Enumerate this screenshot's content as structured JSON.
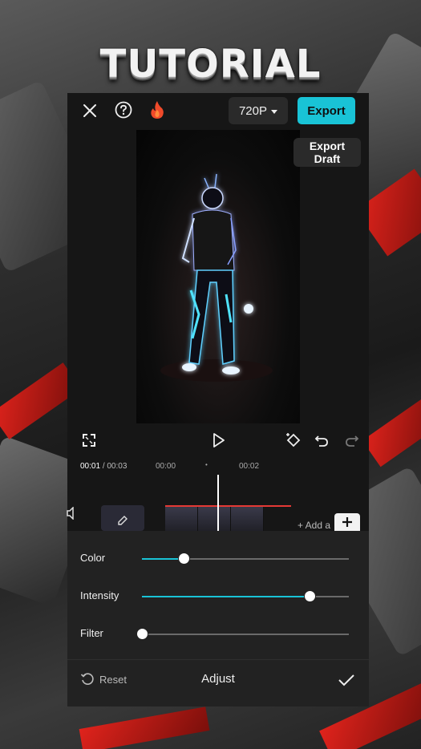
{
  "overlay_title": "TUTORIAL",
  "topbar": {
    "resolution": "720P",
    "export_label": "Export"
  },
  "draft_badge": {
    "line1": "Export",
    "line2": "Draft"
  },
  "timeline": {
    "current_time": "00:01",
    "total_time": "/ 00:03",
    "mark_start": "00:00",
    "mark_dot": "•",
    "mark_end": "00:02",
    "add_label": "+ Add a"
  },
  "adjust": {
    "sliders": [
      {
        "label": "Color",
        "value": 0.2
      },
      {
        "label": "Intensity",
        "value": 0.81
      },
      {
        "label": "Filter",
        "value": 0.0
      }
    ],
    "reset_label": "Reset",
    "panel_title": "Adjust"
  },
  "colors": {
    "accent": "#19c3d6",
    "app_bg": "#161616",
    "panel_bg": "#222222"
  }
}
